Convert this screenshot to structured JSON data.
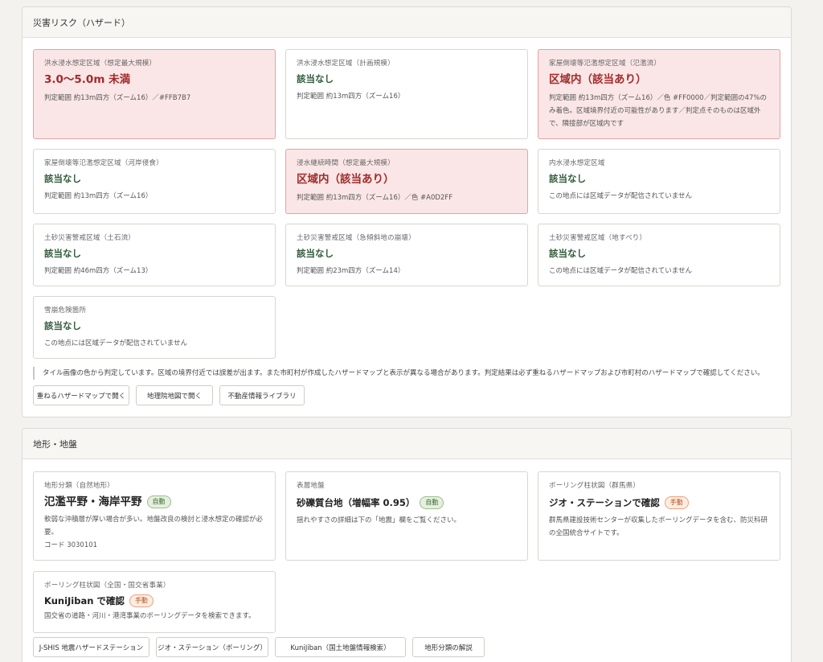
{
  "hazard": {
    "title": "災害リスク（ハザード）",
    "cards": [
      {
        "label": "洪水浸水想定区域（想定最大規模）",
        "value": "3.0〜5.0m 未満",
        "detail": "判定範囲 約13m四方（ズーム16）／#FFB7B7"
      },
      {
        "label": "洪水浸水想定区域（計画規模）",
        "value": "該当なし",
        "detail": "判定範囲 約13m四方（ズーム16）"
      },
      {
        "label": "家屋倒壊等氾濫想定区域（氾濫流）",
        "value": "区域内（該当あり）",
        "detail": "判定範囲 約13m四方（ズーム16）／色 #FF0000／判定範囲の47%のみ着色。区域境界付近の可能性があります／判定点そのものは区域外で、隣接部が区域内です"
      },
      {
        "label": "家屋倒壊等氾濫想定区域（河岸侵食）",
        "value": "該当なし",
        "detail": "判定範囲 約13m四方（ズーム16）"
      },
      {
        "label": "浸水継続時間（想定最大規模）",
        "value": "区域内（該当あり）",
        "detail": "判定範囲 約13m四方（ズーム16）／色 #A0D2FF"
      },
      {
        "label": "内水浸水想定区域",
        "value": "該当なし",
        "detail": "この地点には区域データが配信されていません"
      },
      {
        "label": "土砂災害警戒区域（土石流）",
        "value": "該当なし",
        "detail": "判定範囲 約46m四方（ズーム13）"
      },
      {
        "label": "土砂災害警戒区域（急傾斜地の崩壊）",
        "value": "該当なし",
        "detail": "判定範囲 約23m四方（ズーム14）"
      },
      {
        "label": "土砂災害警戒区域（地すべり）",
        "value": "該当なし",
        "detail": "この地点には区域データが配信されていません"
      },
      {
        "label": "雪崩危険箇所",
        "value": "該当なし",
        "detail": "この地点には区域データが配信されていません"
      }
    ],
    "note": "タイル画像の色から判定しています。区域の境界付近では誤差が出ます。また市町村が作成したハザードマップと表示が異なる場合があります。判定結果は必ず重ねるハザードマップおよび市町村のハザードマップで確認してください。",
    "buttons": [
      "重ねるハザードマップで開く",
      "地理院地図で開く",
      "不動産情報ライブラリ"
    ]
  },
  "terrain": {
    "title": "地形・地盤",
    "cards": [
      {
        "label": "地形分類（自然地形）",
        "value": "氾濫平野・海岸平野",
        "badge": "自動",
        "detail": "軟弱な沖積層が厚い場合が多い。地盤改良の検討と浸水想定の確認が必要。",
        "code": "コード 3030101"
      },
      {
        "label": "表層地盤",
        "value": "砂礫質台地（増幅率 0.95）",
        "badge": "自動",
        "detail": "揺れやすさの詳細は下の「地震」欄をご覧ください。"
      },
      {
        "label": "ボーリング柱状図（群馬県）",
        "value": "ジオ・ステーションで確認",
        "badge": "手動",
        "detail": "群馬県建設技術センターが収集したボーリングデータを含む、防災科研の全国統合サイトです。"
      },
      {
        "label": "ボーリング柱状図（全国・国交省事業）",
        "value": "KuniJiban で確認",
        "badge": "手動",
        "detail": "国交省の道路・河川・港湾事業のボーリングデータを検索できます。"
      }
    ],
    "buttons": [
      "J-SHIS 地震ハザードステーション",
      "ジオ・ステーション（ボーリング）",
      "KuniJiban（国土地盤情報検索）",
      "地形分類の解説"
    ]
  },
  "colors": {
    "hit_bg": "#fae6e6",
    "hit_border": "#e3a4a4",
    "none_text": "#2f5a3a",
    "warn_text": "#a22a2a"
  }
}
